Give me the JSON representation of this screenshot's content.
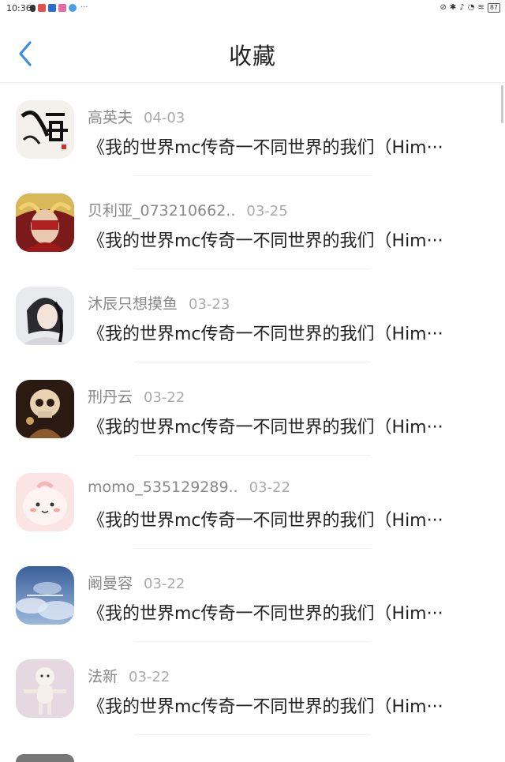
{
  "status_bar": {
    "time": "10:36",
    "more": "···",
    "battery": "87"
  },
  "header": {
    "title": "收藏"
  },
  "items": [
    {
      "name": "高英夫",
      "date": "04-03",
      "message": "《我的世界mc传奇一不同世界的我们（Him···"
    },
    {
      "name": "贝利亚_073210662..",
      "date": "03-25",
      "message": "《我的世界mc传奇一不同世界的我们（Him···"
    },
    {
      "name": "沐辰只想摸鱼",
      "date": "03-23",
      "message": "《我的世界mc传奇一不同世界的我们（Him···"
    },
    {
      "name": "刑丹云",
      "date": "03-22",
      "message": "《我的世界mc传奇一不同世界的我们（Him···"
    },
    {
      "name": "momo_535129289..",
      "date": "03-22",
      "message": "《我的世界mc传奇一不同世界的我们（Him···"
    },
    {
      "name": "阚曼容",
      "date": "03-22",
      "message": "《我的世界mc传奇一不同世界的我们（Him···"
    },
    {
      "name": "法新",
      "date": "03-22",
      "message": "《我的世界mc传奇一不同世界的我们（Him···"
    }
  ],
  "colors": {
    "accent": "#3d8fe0",
    "name_text": "#888888",
    "date_text": "#aaaaaa"
  }
}
